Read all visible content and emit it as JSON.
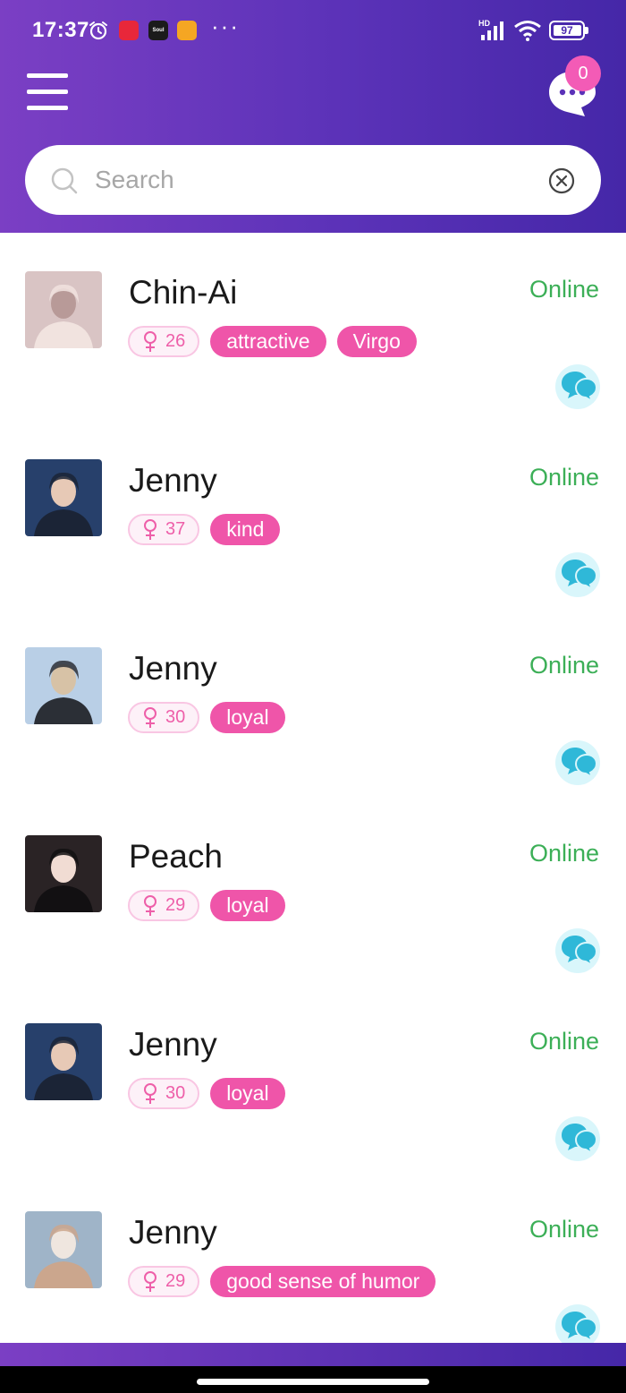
{
  "status_bar": {
    "time": "17:37",
    "battery": "97",
    "network_label": "HD",
    "app_icons": [
      {
        "name": "app-icon-red",
        "color": "#e8273a"
      },
      {
        "name": "app-icon-soul",
        "color": "#1b1b1b",
        "label": "Soul"
      },
      {
        "name": "app-icon-yellow",
        "color": "#f5a623"
      }
    ]
  },
  "header": {
    "chat_badge_count": "0"
  },
  "search": {
    "placeholder": "Search",
    "value": ""
  },
  "users": [
    {
      "name": "Chin-Ai",
      "age": "26",
      "tags": [
        "attractive",
        "Virgo"
      ],
      "status": "Online",
      "avatar_colors": [
        "#d9c4c4",
        "#b89a98",
        "#f1e3df"
      ]
    },
    {
      "name": "Jenny",
      "age": "37",
      "tags": [
        "kind"
      ],
      "status": "Online",
      "avatar_colors": [
        "#27406b",
        "#e7c9b6",
        "#1b2436"
      ]
    },
    {
      "name": "Jenny",
      "age": "30",
      "tags": [
        "loyal"
      ],
      "status": "Online",
      "avatar_colors": [
        "#b9cfe6",
        "#d7c2a6",
        "#2b2f36"
      ]
    },
    {
      "name": "Peach",
      "age": "29",
      "tags": [
        "loyal"
      ],
      "status": "Online",
      "avatar_colors": [
        "#2a2325",
        "#f1dcd3",
        "#121012"
      ]
    },
    {
      "name": "Jenny",
      "age": "30",
      "tags": [
        "loyal"
      ],
      "status": "Online",
      "avatar_colors": [
        "#27406b",
        "#e7c9b6",
        "#1b2436"
      ]
    },
    {
      "name": "Jenny",
      "age": "29",
      "tags": [
        "good sense of humor"
      ],
      "status": "Online",
      "avatar_colors": [
        "#9fb4c8",
        "#efe6df",
        "#cba68d"
      ]
    }
  ],
  "colors": {
    "header_gradient_start": "#7b3fc4",
    "header_gradient_end": "#4527a8",
    "online": "#3caf57",
    "tag_pink": "#ef55a9",
    "badge_pink": "#f35bb6",
    "chat_icon": "#2fb8d8"
  },
  "icons": {
    "menu": "hamburger-menu-icon",
    "messages": "chat-bubble-icon",
    "search": "search-icon",
    "clear": "clear-circle-x-icon",
    "gender": "female-symbol-icon",
    "row_chat": "double-chat-bubble-icon"
  }
}
